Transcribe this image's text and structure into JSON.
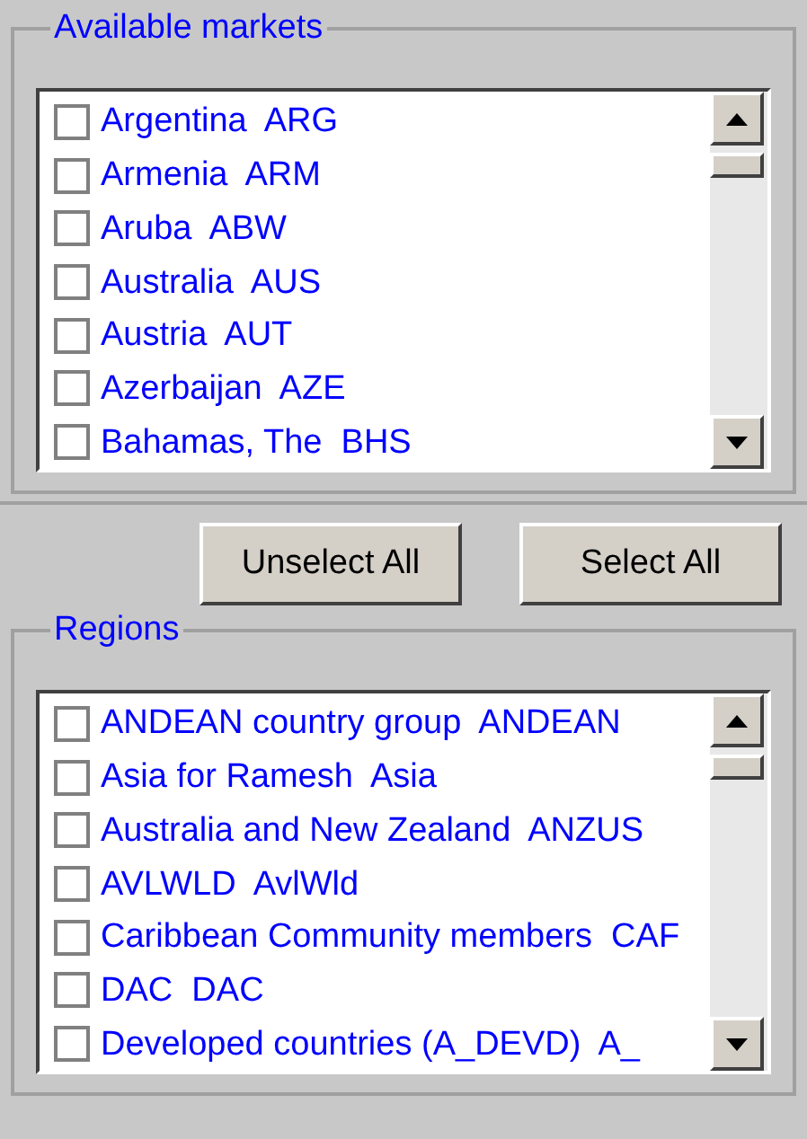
{
  "groups": [
    {
      "title": "Available markets",
      "items": [
        {
          "label": "Argentina  ARG",
          "checked": false
        },
        {
          "label": "Armenia  ARM",
          "checked": false
        },
        {
          "label": "Aruba  ABW",
          "checked": false
        },
        {
          "label": "Australia  AUS",
          "checked": false
        },
        {
          "label": "Austria  AUT",
          "checked": false
        },
        {
          "label": "Azerbaijan  AZE",
          "checked": false
        },
        {
          "label": "Bahamas, The  BHS",
          "checked": false
        }
      ]
    },
    {
      "title": "Regions",
      "items": [
        {
          "label": "ANDEAN country group  ANDEAN",
          "checked": false
        },
        {
          "label": "Asia for Ramesh  Asia",
          "checked": false
        },
        {
          "label": "Australia and New Zealand  ANZUS",
          "checked": false
        },
        {
          "label": "AVLWLD  AvlWld",
          "checked": false
        },
        {
          "label": "Caribbean Community members  CAF",
          "checked": false
        },
        {
          "label": "DAC  DAC",
          "checked": false
        },
        {
          "label": "Developed countries (A_DEVD)  A_",
          "checked": false
        }
      ]
    }
  ],
  "buttons": [
    {
      "label": "Unselect All"
    },
    {
      "label": "Select All"
    }
  ]
}
